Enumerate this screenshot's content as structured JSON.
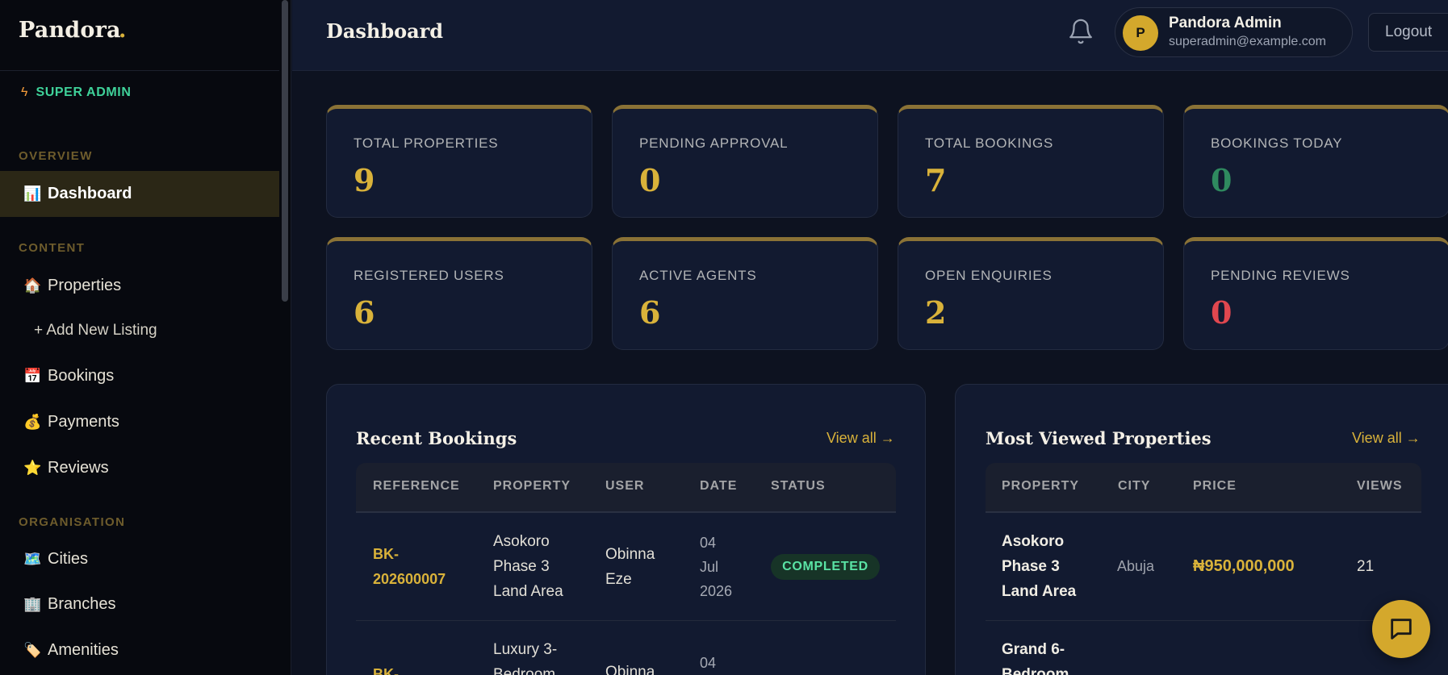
{
  "brand": {
    "name": "Pandora",
    "dot": "."
  },
  "role": {
    "label": "SUPER ADMIN",
    "icon": "lightning-icon"
  },
  "sidebar": {
    "sections": [
      {
        "label": "OVERVIEW"
      },
      {
        "label": "CONTENT"
      },
      {
        "label": "ORGANISATION"
      }
    ],
    "items": [
      {
        "label": "Dashboard",
        "icon": "📊"
      },
      {
        "label": "Properties",
        "icon": "🏠"
      },
      {
        "label": "+ Add New Listing"
      },
      {
        "label": "Bookings",
        "icon": "📅"
      },
      {
        "label": "Payments",
        "icon": "💰"
      },
      {
        "label": "Reviews",
        "icon": "⭐"
      },
      {
        "label": "Cities",
        "icon": "🗺️"
      },
      {
        "label": "Branches",
        "icon": "🏢"
      },
      {
        "label": "Amenities",
        "icon": "🏷️"
      }
    ]
  },
  "header": {
    "title": "Dashboard",
    "user": {
      "initial": "P",
      "name": "Pandora Admin",
      "email": "superadmin@example.com"
    },
    "logout_label": "Logout"
  },
  "stats": [
    {
      "label": "TOTAL PROPERTIES",
      "value": "9",
      "color": "#d9b23a"
    },
    {
      "label": "PENDING APPROVAL",
      "value": "0",
      "color": "#d9b23a"
    },
    {
      "label": "TOTAL BOOKINGS",
      "value": "7",
      "color": "#d9b23a"
    },
    {
      "label": "BOOKINGS TODAY",
      "value": "0",
      "color": "#2f8a5f"
    },
    {
      "label": "REGISTERED USERS",
      "value": "6",
      "color": "#d9b23a"
    },
    {
      "label": "ACTIVE AGENTS",
      "value": "6",
      "color": "#d9b23a"
    },
    {
      "label": "OPEN ENQUIRIES",
      "value": "2",
      "color": "#d9b23a"
    },
    {
      "label": "PENDING REVIEWS",
      "value": "0",
      "color": "#e0474f"
    }
  ],
  "recent_bookings": {
    "title": "Recent Bookings",
    "view_all": "View all →",
    "columns": [
      "REFERENCE",
      "PROPERTY",
      "USER",
      "DATE",
      "STATUS"
    ],
    "rows": [
      {
        "reference": [
          "BK-",
          "202600007"
        ],
        "property": [
          "Asokoro",
          "Phase 3",
          "Land Area"
        ],
        "user": [
          "Obinna",
          "Eze"
        ],
        "date": [
          "04",
          "Jul",
          "2026"
        ],
        "status": "COMPLETED"
      },
      {
        "reference": [
          "BK-"
        ],
        "property": [
          "Luxury 3-",
          "Bedroom"
        ],
        "user": [
          "Obinna"
        ],
        "date": [
          "04"
        ]
      }
    ]
  },
  "most_viewed": {
    "title": "Most Viewed Properties",
    "view_all": "View all →",
    "columns": [
      "PROPERTY",
      "CITY",
      "PRICE",
      "VIEWS"
    ],
    "rows": [
      {
        "property": [
          "Asokoro",
          "Phase 3",
          "Land Area"
        ],
        "city": "Abuja",
        "price": "₦950,000,000",
        "views": "21"
      },
      {
        "property": [
          "Grand 6-",
          "Bedroom"
        ]
      }
    ]
  },
  "colors": {
    "accent": "#d4a82c",
    "success": "#5ae3a5",
    "danger": "#e0474f",
    "bg": "#0d1220",
    "card": "#121a30"
  }
}
